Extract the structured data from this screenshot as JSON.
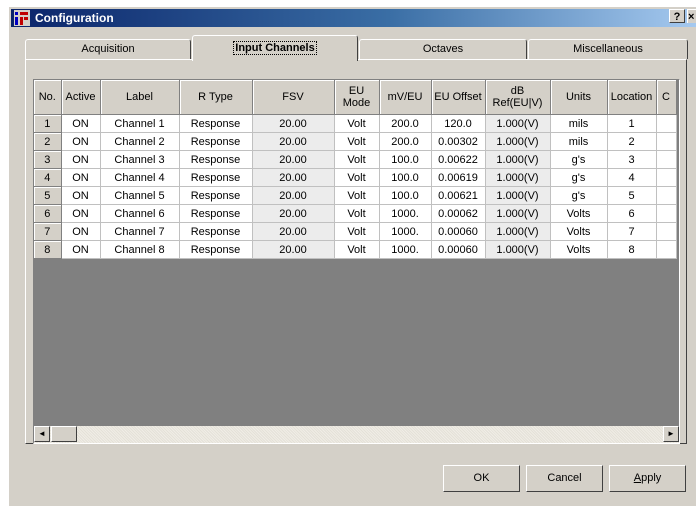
{
  "window": {
    "title": "Configuration",
    "help_label": "?",
    "close_label": "×"
  },
  "tabs": [
    {
      "label": "Acquisition",
      "active": false
    },
    {
      "label": "Input Channels",
      "active": true
    },
    {
      "label": "Octaves",
      "active": false
    },
    {
      "label": "Miscellaneous",
      "active": false
    }
  ],
  "grid": {
    "headers": [
      "No.",
      "Active",
      "Label",
      "R Type",
      "FSV",
      "EU\nMode",
      "mV/EU",
      "EU Offset",
      "dB\nRef(EU|V)",
      "Units",
      "Location",
      "C"
    ],
    "rows": [
      [
        "1",
        "ON",
        "Channel 1",
        "Response",
        "20.00",
        "Volt",
        "200.0",
        "120.0",
        "1.000(V)",
        "mils",
        "1"
      ],
      [
        "2",
        "ON",
        "Channel 2",
        "Response",
        "20.00",
        "Volt",
        "200.0",
        "0.00302",
        "1.000(V)",
        "mils",
        "2"
      ],
      [
        "3",
        "ON",
        "Channel 3",
        "Response",
        "20.00",
        "Volt",
        "100.0",
        "0.00622",
        "1.000(V)",
        "g's",
        "3"
      ],
      [
        "4",
        "ON",
        "Channel 4",
        "Response",
        "20.00",
        "Volt",
        "100.0",
        "0.00619",
        "1.000(V)",
        "g's",
        "4"
      ],
      [
        "5",
        "ON",
        "Channel 5",
        "Response",
        "20.00",
        "Volt",
        "100.0",
        "0.00621",
        "1.000(V)",
        "g's",
        "5"
      ],
      [
        "6",
        "ON",
        "Channel 6",
        "Response",
        "20.00",
        "Volt",
        "1000.",
        "0.00062",
        "1.000(V)",
        "Volts",
        "6"
      ],
      [
        "7",
        "ON",
        "Channel 7",
        "Response",
        "20.00",
        "Volt",
        "1000.",
        "0.00060",
        "1.000(V)",
        "Volts",
        "7"
      ],
      [
        "8",
        "ON",
        "Channel 8",
        "Response",
        "20.00",
        "Volt",
        "1000.",
        "0.00060",
        "1.000(V)",
        "Volts",
        "8"
      ]
    ]
  },
  "scrollbar": {
    "left_arrow": "◄",
    "right_arrow": "►"
  },
  "buttons": {
    "ok": "OK",
    "cancel": "Cancel",
    "apply_first": "A",
    "apply_rest": "pply"
  },
  "colors": {
    "titlebar_start": "#0a246a",
    "titlebar_end": "#a6caf0",
    "face": "#d4d0c8",
    "grid_empty": "#808080"
  }
}
